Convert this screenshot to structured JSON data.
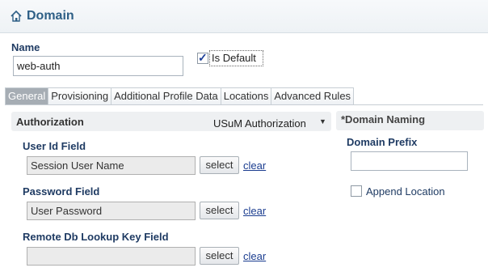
{
  "header": {
    "title": "Domain",
    "icon": "home-icon"
  },
  "name": {
    "label": "Name",
    "value": "web-auth"
  },
  "is_default": {
    "label": "Is Default",
    "checked": true
  },
  "tabs": [
    {
      "label": "General",
      "active": true
    },
    {
      "label": "Provisioning",
      "active": false
    },
    {
      "label": "Additional Profile Data",
      "active": false
    },
    {
      "label": "Locations",
      "active": false
    },
    {
      "label": "Advanced Rules",
      "active": false
    }
  ],
  "authorization": {
    "title": "Authorization",
    "selected": "USuM Authorization",
    "fields": [
      {
        "label": "User Id Field",
        "value": "Session User Name",
        "select_label": "select",
        "clear_label": "clear"
      },
      {
        "label": "Password Field",
        "value": "User Password",
        "select_label": "select",
        "clear_label": "clear"
      },
      {
        "label": "Remote Db Lookup Key Field",
        "value": "",
        "select_label": "select",
        "clear_label": "clear"
      }
    ]
  },
  "domain_naming": {
    "title": "*Domain Naming",
    "prefix_label": "Domain Prefix",
    "prefix_value": "",
    "append_location_label": "Append Location",
    "append_location_checked": false
  },
  "colors": {
    "title": "#2e5f86",
    "label": "#1f3b63",
    "link": "#1a3c8f",
    "active_tab": "#a6adb4"
  }
}
